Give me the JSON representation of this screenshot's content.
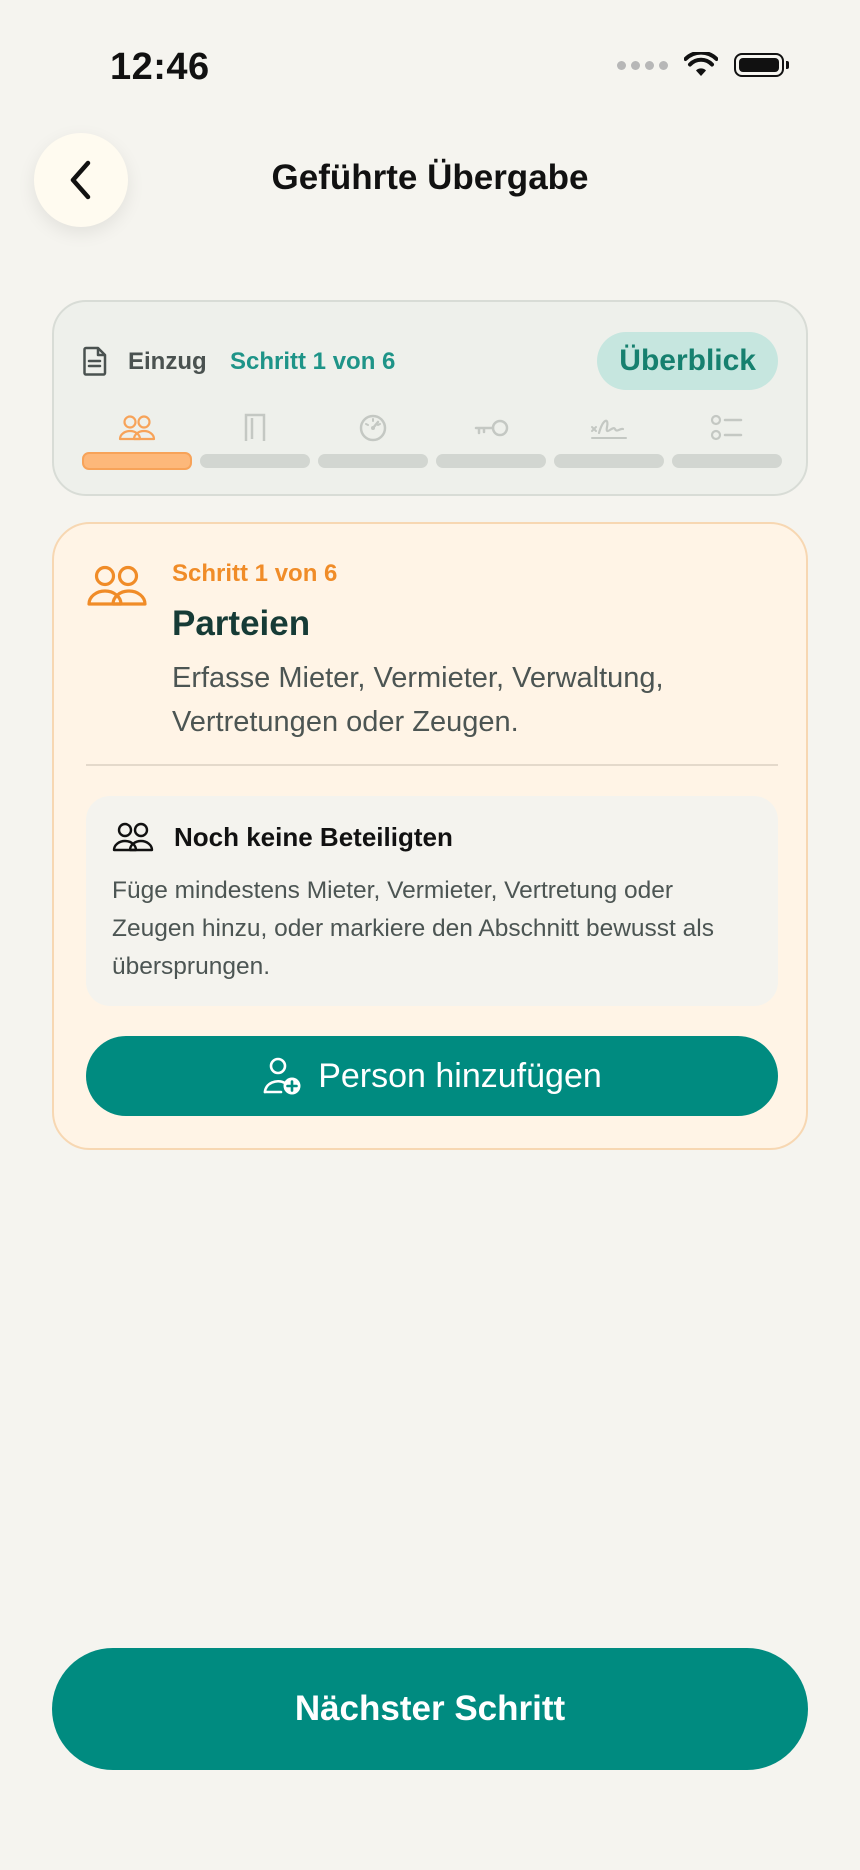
{
  "status_bar": {
    "time": "12:46"
  },
  "header": {
    "title": "Geführte Übergabe",
    "back_icon": "chevron-left-icon"
  },
  "progress": {
    "mode_label": "Einzug",
    "step_label": "Schritt 1 von 6",
    "overview_button": "Überblick",
    "current_step": 1,
    "total_steps": 6,
    "steps": [
      {
        "icon": "people-icon",
        "active": true
      },
      {
        "icon": "door-icon",
        "active": false
      },
      {
        "icon": "meter-gauge-icon",
        "active": false
      },
      {
        "icon": "key-icon",
        "active": false
      },
      {
        "icon": "signature-icon",
        "active": false
      },
      {
        "icon": "checklist-icon",
        "active": false
      }
    ]
  },
  "step_card": {
    "kicker": "Schritt 1 von 6",
    "title": "Parteien",
    "description": "Erfasse Mieter, Vermieter, Verwaltung, Vertretungen oder Zeugen.",
    "empty_state": {
      "title": "Noch keine Beteiligten",
      "text": "Füge mindestens Mieter, Vermieter, Vertretung oder Zeugen hinzu, oder markiere den Abschnitt bewusst als übersprungen."
    },
    "add_button": "Person hinzufügen"
  },
  "footer": {
    "next_button": "Nächster Schritt"
  },
  "colors": {
    "accent": "#008B80",
    "accent_light": "#C6E6DF",
    "step_active": "#F08C28",
    "card_background": "#FFF4E6",
    "page_background": "#F5F4EF"
  }
}
